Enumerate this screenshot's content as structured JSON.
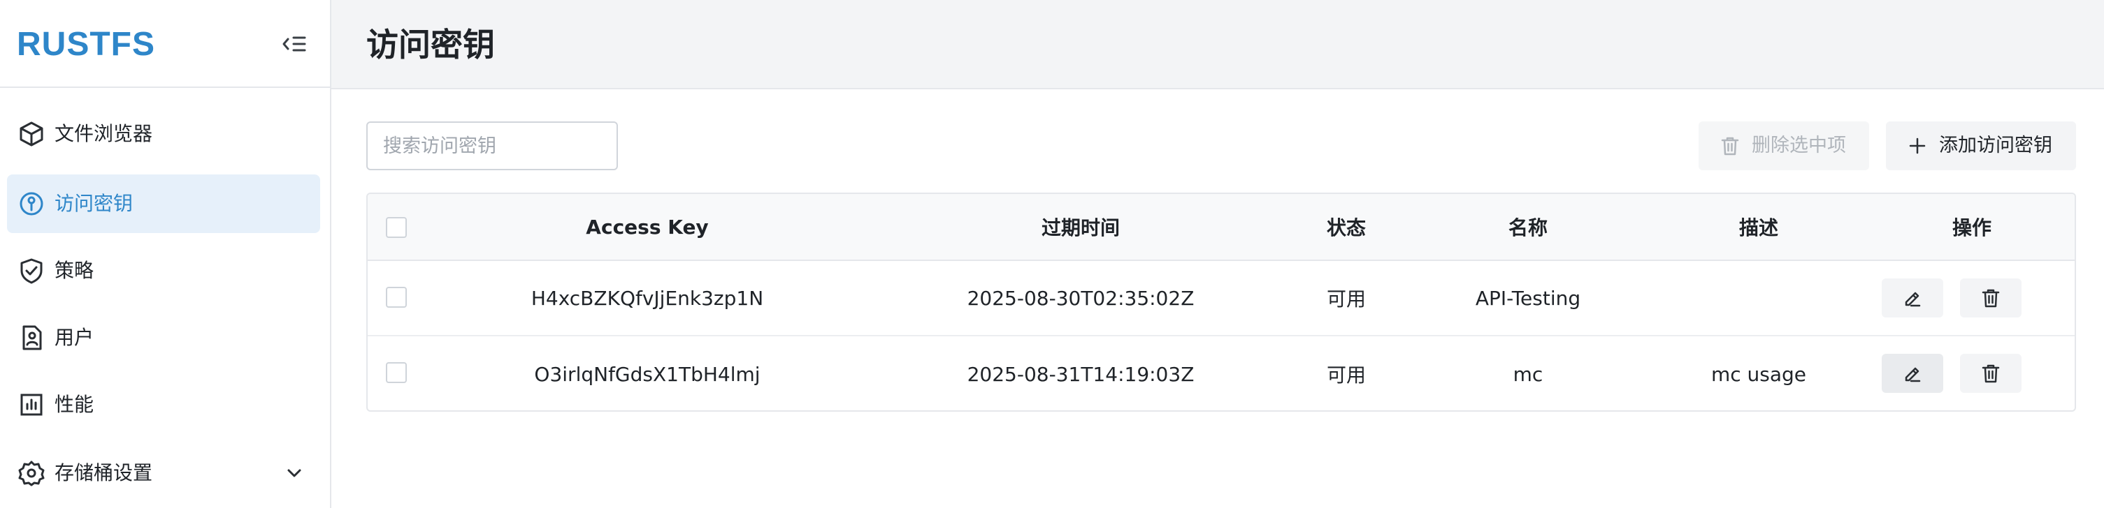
{
  "app": {
    "logo": "RUSTFS"
  },
  "sidebar": {
    "items": [
      {
        "label": "文件浏览器",
        "icon": "cube-icon",
        "active": false
      },
      {
        "label": "访问密钥",
        "icon": "key-circle-icon",
        "active": true
      },
      {
        "label": "策略",
        "icon": "shield-check-icon",
        "active": false
      },
      {
        "label": "用户",
        "icon": "user-badge-icon",
        "active": false
      },
      {
        "label": "性能",
        "icon": "bar-chart-icon",
        "active": false
      },
      {
        "label": "存储桶设置",
        "icon": "gear-icon",
        "active": false,
        "expandable": true
      }
    ]
  },
  "header": {
    "title": "访问密钥"
  },
  "toolbar": {
    "search_placeholder": "搜索访问密钥",
    "search_value": "",
    "delete_label": "删除选中项",
    "add_label": "添加访问密钥"
  },
  "table": {
    "columns": [
      "Access Key",
      "过期时间",
      "状态",
      "名称",
      "描述",
      "操作"
    ],
    "rows": [
      {
        "access_key": "H4xcBZKQfvJjEnk3zp1N",
        "expiry": "2025-08-30T02:35:02Z",
        "status": "可用",
        "name": "API-Testing",
        "description": ""
      },
      {
        "access_key": "O3irlqNfGdsX1TbH4lmj",
        "expiry": "2025-08-31T14:19:03Z",
        "status": "可用",
        "name": "mc",
        "description": "mc usage"
      }
    ]
  },
  "colors": {
    "accent": "#2e86c9",
    "active_bg": "#e6f0fa",
    "topbar_bg": "#f3f4f6",
    "border": "#e5e7eb"
  }
}
